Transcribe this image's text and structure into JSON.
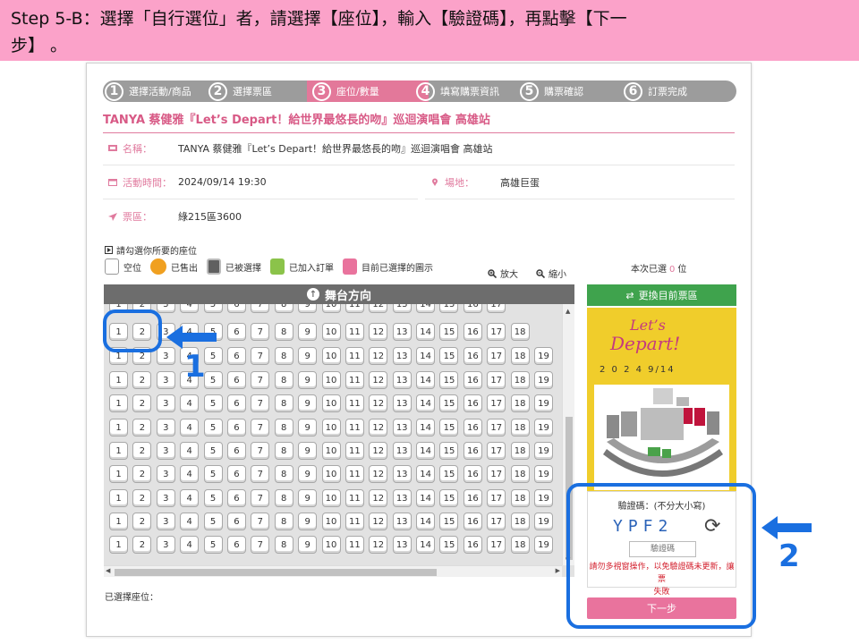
{
  "banner": {
    "line1": "Step 5-B：選擇「自行選位」者，請選擇【座位】，輸入【驗證碼】，再點擊【下一",
    "line2": "步】 。"
  },
  "steps": [
    {
      "num": "1",
      "label": "選擇活動/商品"
    },
    {
      "num": "2",
      "label": "選擇票區"
    },
    {
      "num": "3",
      "label": "座位/數量"
    },
    {
      "num": "4",
      "label": "填寫購票資訊"
    },
    {
      "num": "5",
      "label": "購票確認"
    },
    {
      "num": "6",
      "label": "訂票完成"
    }
  ],
  "active_step": "3",
  "event_title": "TANYA 蔡健雅『Let’s Depart！給世界最悠長的吻』巡迴演唱會 高雄站",
  "info": {
    "name_label": "名稱：",
    "name_value": "TANYA 蔡健雅『Let’s Depart！給世界最悠長的吻』巡迴演唱會 高雄站",
    "time_label": "活動時間：",
    "time_value": "2024/09/14 19:30",
    "venue_label": "場地：",
    "venue_value": "高雄巨蛋",
    "area_label": "票區：",
    "area_value": "綠215區3600"
  },
  "hint": "請勾選你所要的座位",
  "legend": [
    {
      "label": "空位",
      "color": "#ffffff",
      "icon": "empty-seat-icon"
    },
    {
      "label": "已售出",
      "color": "#f0a020",
      "icon": "sold-seat-icon"
    },
    {
      "label": "已被選擇",
      "color": "#606060",
      "icon": "taken-seat-icon"
    },
    {
      "label": "已加入訂單",
      "color": "#8bc34a",
      "icon": "ordered-seat-icon"
    },
    {
      "label": "目前已選擇的圖示",
      "color": "#e9739d",
      "icon": "selected-seat-icon"
    }
  ],
  "zoom_in": "放大",
  "zoom_out": "縮小",
  "selected_count": {
    "prefix": "本次已選",
    "value": "0",
    "suffix": "位"
  },
  "stage_label": "舞台方向",
  "seat_rows_count_note": "rows of numbered seats",
  "seat_rows": [
    [
      "1",
      "2",
      "3",
      "4",
      "5",
      "6",
      "7",
      "8",
      "9",
      "10",
      "11",
      "12",
      "13",
      "14",
      "15",
      "16",
      "17"
    ],
    [
      "1",
      "2",
      "3",
      "4",
      "5",
      "6",
      "7",
      "8",
      "9",
      "10",
      "11",
      "12",
      "13",
      "14",
      "15",
      "16",
      "17",
      "18"
    ],
    [
      "1",
      "2",
      "3",
      "4",
      "5",
      "6",
      "7",
      "8",
      "9",
      "10",
      "11",
      "12",
      "13",
      "14",
      "15",
      "16",
      "17",
      "18",
      "19"
    ],
    [
      "1",
      "2",
      "3",
      "4",
      "5",
      "6",
      "7",
      "8",
      "9",
      "10",
      "11",
      "12",
      "13",
      "14",
      "15",
      "16",
      "17",
      "18",
      "19"
    ],
    [
      "1",
      "2",
      "3",
      "4",
      "5",
      "6",
      "7",
      "8",
      "9",
      "10",
      "11",
      "12",
      "13",
      "14",
      "15",
      "16",
      "17",
      "18",
      "19"
    ],
    [
      "1",
      "2",
      "3",
      "4",
      "5",
      "6",
      "7",
      "8",
      "9",
      "10",
      "11",
      "12",
      "13",
      "14",
      "15",
      "16",
      "17",
      "18",
      "19"
    ],
    [
      "1",
      "2",
      "3",
      "4",
      "5",
      "6",
      "7",
      "8",
      "9",
      "10",
      "11",
      "12",
      "13",
      "14",
      "15",
      "16",
      "17",
      "18",
      "19"
    ],
    [
      "1",
      "2",
      "3",
      "4",
      "5",
      "6",
      "7",
      "8",
      "9",
      "10",
      "11",
      "12",
      "13",
      "14",
      "15",
      "16",
      "17",
      "18",
      "19"
    ],
    [
      "1",
      "2",
      "3",
      "4",
      "5",
      "6",
      "7",
      "8",
      "9",
      "10",
      "11",
      "12",
      "13",
      "14",
      "15",
      "16",
      "17",
      "18",
      "19"
    ],
    [
      "1",
      "2",
      "3",
      "4",
      "5",
      "6",
      "7",
      "8",
      "9",
      "10",
      "11",
      "12",
      "13",
      "14",
      "15",
      "16",
      "17",
      "18",
      "19"
    ],
    [
      "1",
      "2",
      "3",
      "4",
      "5",
      "6",
      "7",
      "8",
      "9",
      "10",
      "11",
      "12",
      "13",
      "14",
      "15",
      "16",
      "17",
      "18",
      "19"
    ]
  ],
  "selected_seats_label": "已選擇座位：",
  "change_area_button": "更換目前票區",
  "poster": {
    "title1": "Let’s",
    "title2": "Depart!",
    "date": "2 0 2 4   9/14"
  },
  "captcha": {
    "label": "驗證碼：(不分大小寫)",
    "code": "YPF2",
    "placeholder": "驗證碼",
    "warning_line1": "請勿多視窗操作，以免驗證碼未更新，讓票",
    "warning_line2": "失敗"
  },
  "next_button": "下一步",
  "annotations": {
    "one": "1",
    "two": "2"
  },
  "colors": {
    "banner": "#fba2c9",
    "accent": "#e07a9e",
    "callout": "#1a6fe0",
    "green": "#3fa34d"
  }
}
